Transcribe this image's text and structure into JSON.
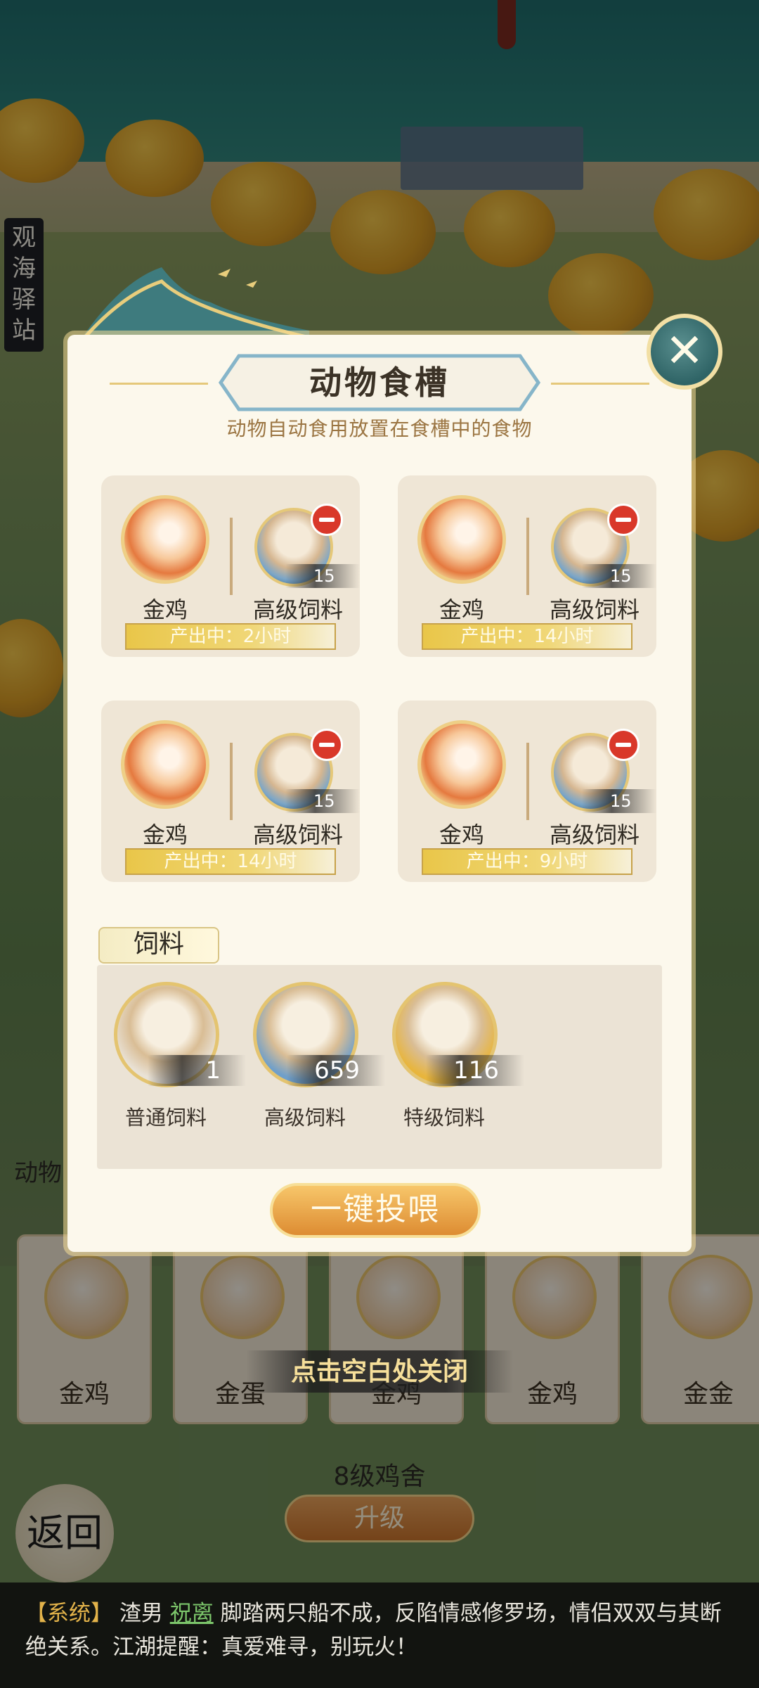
{
  "background": {
    "location_sign": "观海驿站",
    "animal_strip_label": "动物",
    "animals": [
      "金鸡",
      "金蛋",
      "金鸡",
      "金鸡",
      "金金"
    ],
    "coop_level": "8级鸡舍",
    "upgrade_label": "升级",
    "back_label": "返回"
  },
  "popup": {
    "title": "动物食槽",
    "subtitle": "动物自动食用放置在食槽中的食物",
    "slots": [
      {
        "animal": "金鸡",
        "feed": "高级饲料",
        "qty": "15",
        "status": "产出中：2小时"
      },
      {
        "animal": "金鸡",
        "feed": "高级饲料",
        "qty": "15",
        "status": "产出中：14小时"
      },
      {
        "animal": "金鸡",
        "feed": "高级饲料",
        "qty": "15",
        "status": "产出中：14小时"
      },
      {
        "animal": "金鸡",
        "feed": "高级饲料",
        "qty": "15",
        "status": "产出中：9小时"
      }
    ],
    "feed_tab": "饲料",
    "inventory": [
      {
        "label": "普通饲料",
        "count": "1",
        "ring_color": "#e9e2d6"
      },
      {
        "label": "高级饲料",
        "count": "659",
        "ring_color": "#6f9fca"
      },
      {
        "label": "特级饲料",
        "count": "116",
        "ring_color": "#e8b53c"
      }
    ],
    "feed_all_label": "一键投喂",
    "close_hint": "点击空白处关闭"
  },
  "chat": {
    "prefix": "【系统】",
    "part1": "渣男",
    "player": "祝离",
    "message": "脚踏两只船不成，反陷情感修罗场，情侣双双与其断绝关系。江湖提醒：真爱难寻，别玩火！"
  },
  "colors": {
    "accent_gold": "#e5c879",
    "panel_bg": "#fcf8ec",
    "close_teal": "#2f6466",
    "button_orange": "#dd8c32"
  }
}
